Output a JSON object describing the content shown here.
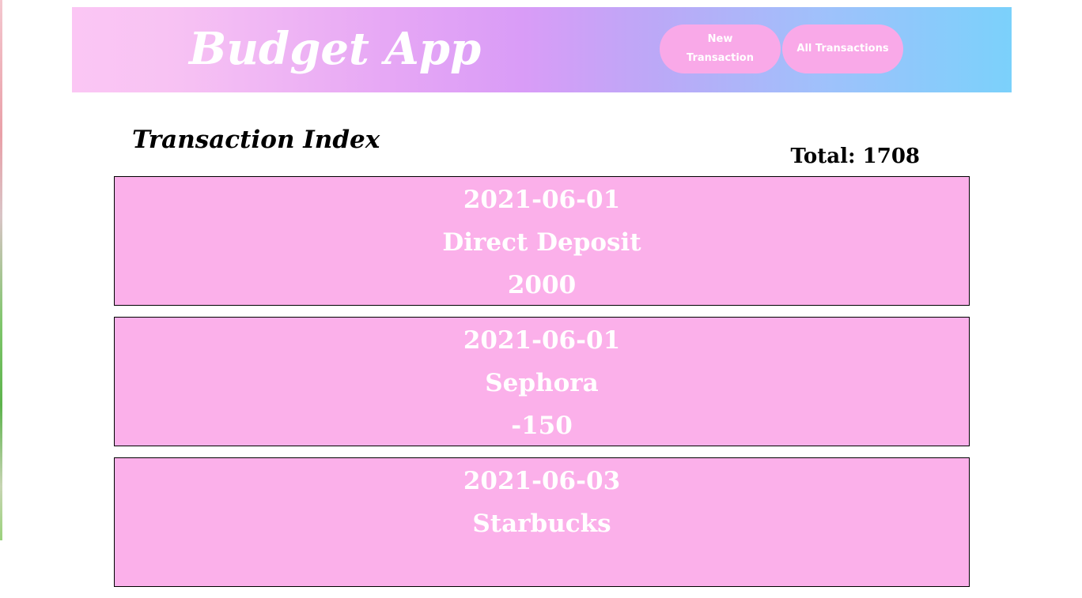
{
  "header": {
    "app_title": "Budget App",
    "nav": {
      "new_transaction_line1": "New",
      "new_transaction_line2": "Transaction",
      "all_transactions": "All Transactions"
    }
  },
  "main": {
    "title": "Transaction Index",
    "total_label": "Total: 1708"
  },
  "transactions": [
    {
      "date": "2021-06-01",
      "name": "Direct Deposit",
      "amount": "2000"
    },
    {
      "date": "2021-06-01",
      "name": "Sephora",
      "amount": "-150"
    },
    {
      "date": "2021-06-03",
      "name": "Starbucks",
      "amount": ""
    }
  ],
  "colors": {
    "card_bg": "#fbb0ea",
    "nav_button_bg": "#f9a9e8",
    "header_gradient_start": "#fbc6f4",
    "header_gradient_mid": "#d99cf7",
    "header_gradient_end": "#7bd1fb"
  }
}
